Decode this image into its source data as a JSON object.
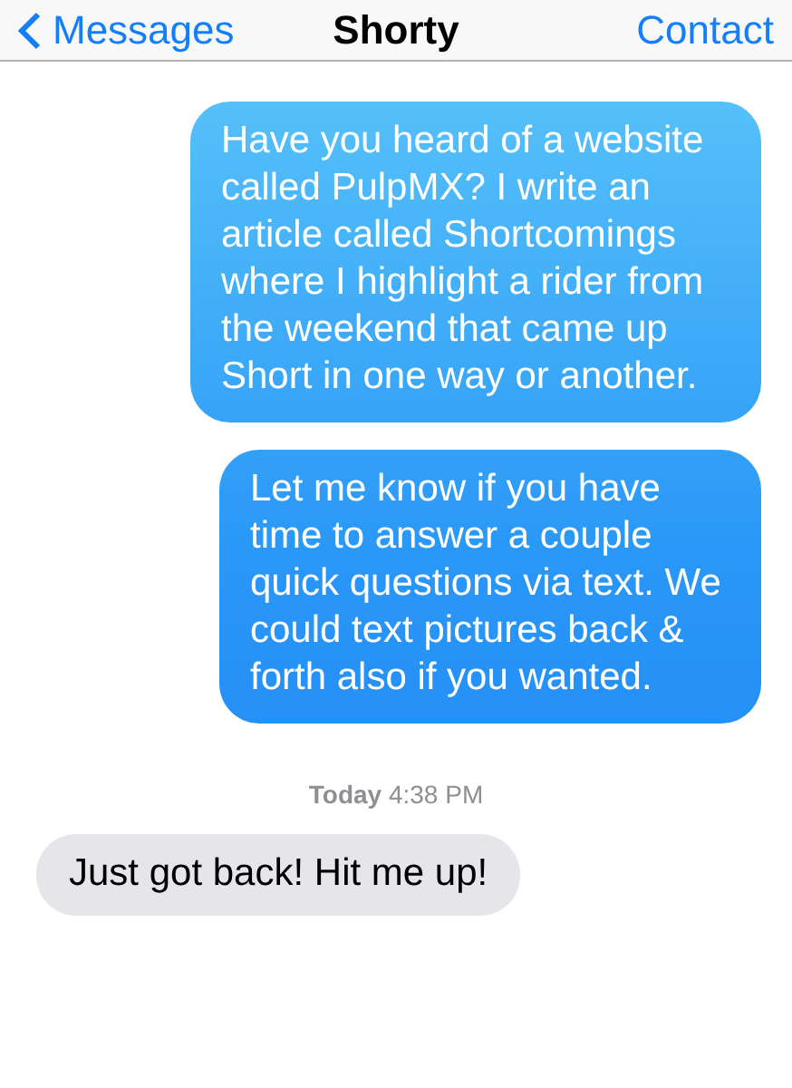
{
  "nav": {
    "back": "Messages",
    "title": "Shorty",
    "action": "Contact"
  },
  "messages": [
    {
      "kind": "outgoing",
      "text": "Have you heard of a website called PulpMX?  I write an article called Shortcomings where I highlight a rider from the weekend that came up Short in one way or another."
    },
    {
      "kind": "outgoing",
      "text": "Let me know if you have time to answer a couple quick questions via text. We could text pictures back & forth also if you wanted."
    },
    {
      "kind": "timestamp",
      "day": "Today",
      "time": "4:38 PM"
    },
    {
      "kind": "incoming",
      "text": "Just got back! Hit me up!"
    }
  ]
}
